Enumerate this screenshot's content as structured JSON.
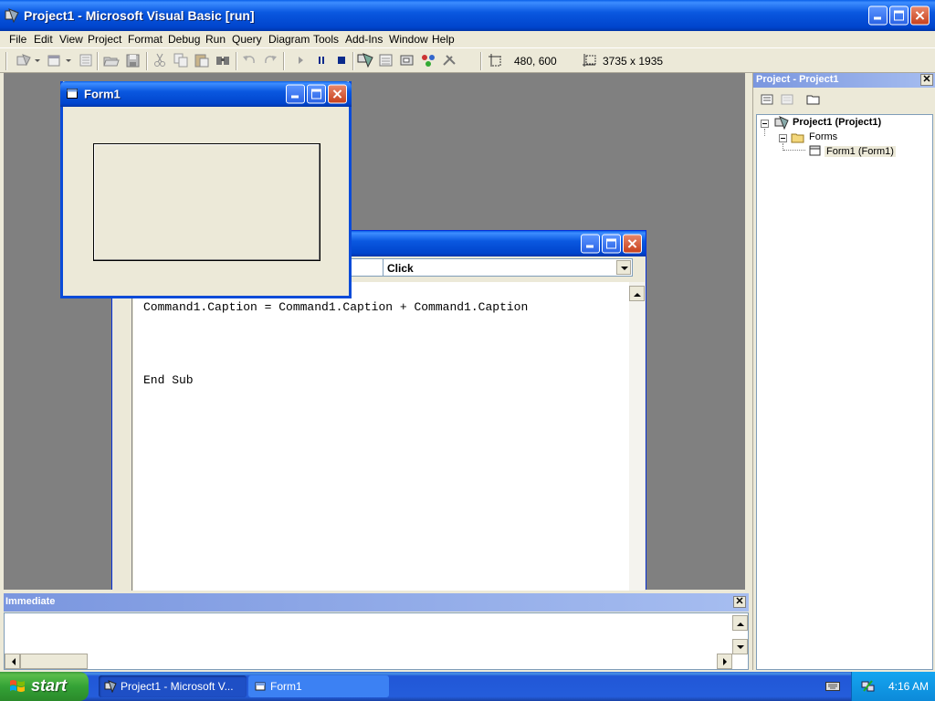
{
  "app": {
    "title": "Project1 - Microsoft Visual Basic [run]"
  },
  "menu": [
    "File",
    "Edit",
    "View",
    "Project",
    "Format",
    "Debug",
    "Run",
    "Query",
    "Diagram",
    "Tools",
    "Add-Ins",
    "Window",
    "Help"
  ],
  "toolbar": {
    "position_readout": "480, 600",
    "size_readout": "3735 x 1935"
  },
  "code_window": {
    "object_combo": "",
    "procedure_combo": "Click",
    "lines": [
      "Command1.Caption = Command1.Caption + Command1.Caption",
      "End Sub"
    ]
  },
  "form1": {
    "title": "Form1"
  },
  "project_explorer": {
    "title": "Project - Project1",
    "root": "Project1 (Project1)",
    "folder": "Forms",
    "item": "Form1 (Form1)"
  },
  "immediate": {
    "title": "Immediate"
  },
  "taskbar": {
    "start": "start",
    "tasks": [
      "Project1 - Microsoft V...",
      "Form1"
    ],
    "time": "4:16 AM"
  }
}
